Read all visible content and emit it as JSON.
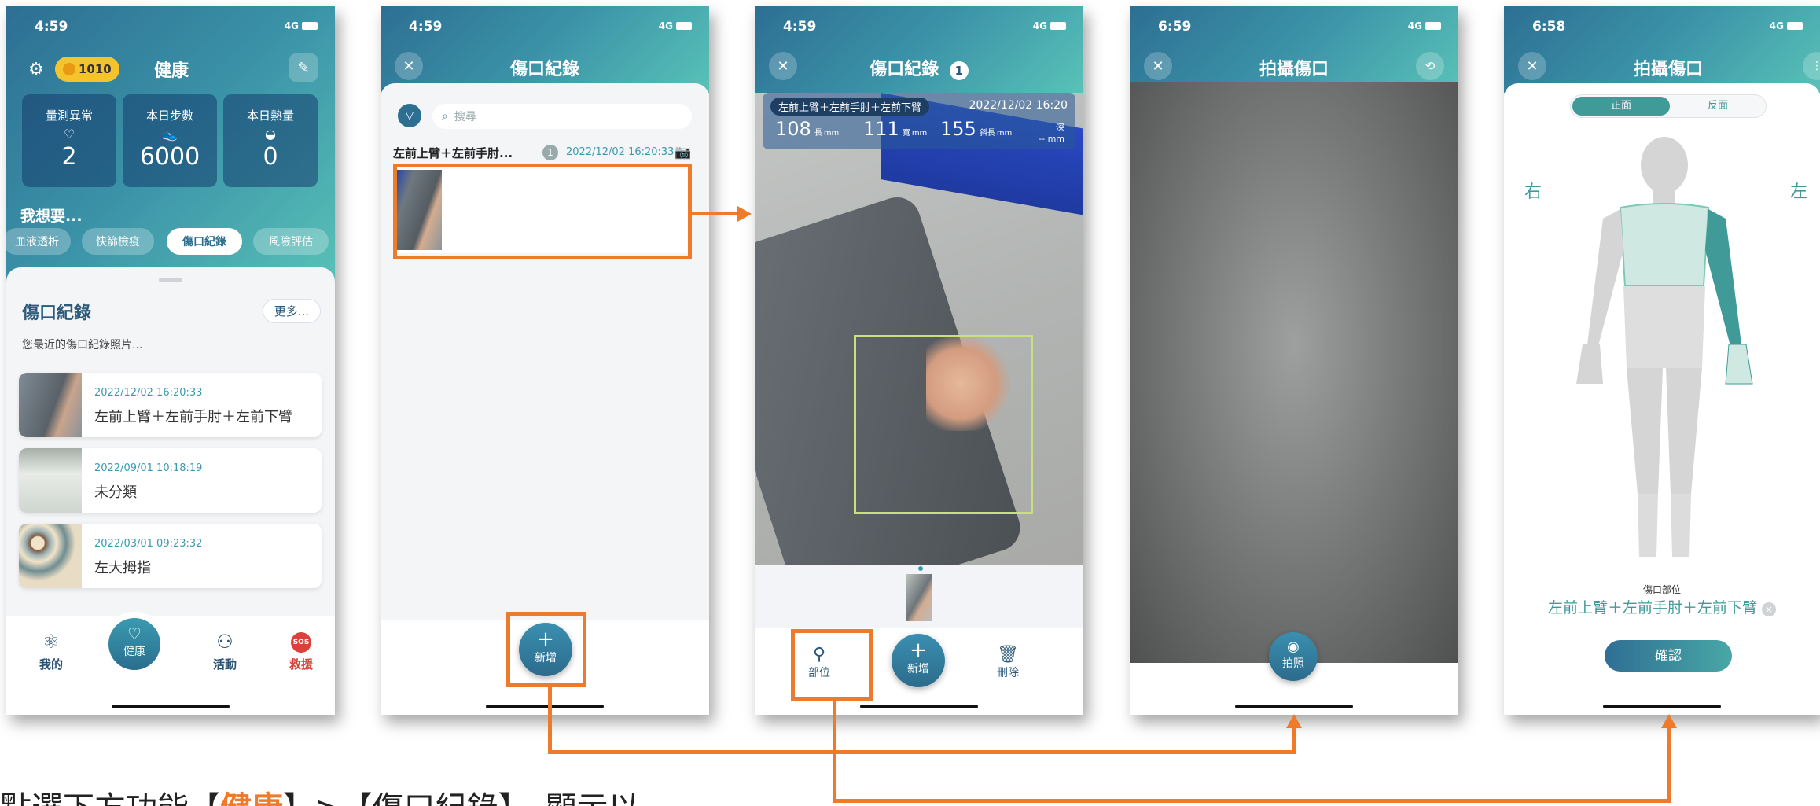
{
  "phone1": {
    "time": "4:59",
    "signal": "4G",
    "title": "健康",
    "coin": "1010",
    "stats": [
      {
        "label": "量測異常",
        "value": "2",
        "icon": "heart-pulse-icon"
      },
      {
        "label": "本日步數",
        "value": "6000",
        "icon": "shoe-icon"
      },
      {
        "label": "本日熱量",
        "value": "0",
        "icon": "food-icon"
      }
    ],
    "want_label": "我想要...",
    "chips": [
      "血液透析",
      "快篩檢疫",
      "傷口紀錄",
      "風險評估"
    ],
    "section_title": "傷口紀錄",
    "more_label": "更多...",
    "recent_label": "您最近的傷口紀錄照片...",
    "records": [
      {
        "date": "2022/12/02 16:20:33",
        "name": "左前上臂＋左前手肘＋左前下臂"
      },
      {
        "date": "2022/09/01 10:18:19",
        "name": "未分類"
      },
      {
        "date": "2022/03/01 09:23:32",
        "name": "左大拇指"
      }
    ],
    "tabs": {
      "mine": "我的",
      "health": "健康",
      "activity": "活動",
      "rescue": "救援",
      "sos": "SOS"
    }
  },
  "phone2": {
    "time": "4:59",
    "signal": "4G",
    "title": "傷口紀錄",
    "search_placeholder": "搜尋",
    "group_title": "左前上臂＋左前手肘...",
    "group_count": "1",
    "group_date": "2022/12/02 16:20:33",
    "add_label": "新增"
  },
  "phone3": {
    "time": "4:59",
    "signal": "4G",
    "title": "傷口紀錄",
    "badge": "1",
    "part_label": "左前上臂＋左前手肘＋左前下臂",
    "date": "2022/12/02 16:20",
    "measures": [
      {
        "value": "108",
        "unit_top": "長",
        "unit": "mm"
      },
      {
        "value": "111",
        "unit_top": "寬",
        "unit": "mm"
      },
      {
        "value": "155",
        "unit_top": "斜長",
        "unit": "mm"
      },
      {
        "value": "--",
        "unit_top": "深",
        "unit": "mm"
      }
    ],
    "part_btn": "部位",
    "add_btn": "新增",
    "delete_btn": "刪除"
  },
  "phone4": {
    "time": "6:59",
    "signal": "4G",
    "title": "拍攝傷口",
    "shoot_label": "拍照"
  },
  "phone5": {
    "time": "6:58",
    "signal": "4G",
    "title": "拍攝傷口",
    "seg_front": "正面",
    "seg_back": "反面",
    "right_label": "右",
    "left_label": "左",
    "part_caption": "傷口部位",
    "part_value": "左前上臂＋左前手肘＋左前下臂",
    "confirm_label": "確認"
  },
  "caption": {
    "pre": "點選下方功能【",
    "highlight": "健康",
    "post": "】>【傷口紀錄】，顯示以"
  },
  "colors": {
    "accent_orange": "#ee7a2c",
    "teal": "#3b93a8",
    "navy": "#2c5a7a"
  }
}
